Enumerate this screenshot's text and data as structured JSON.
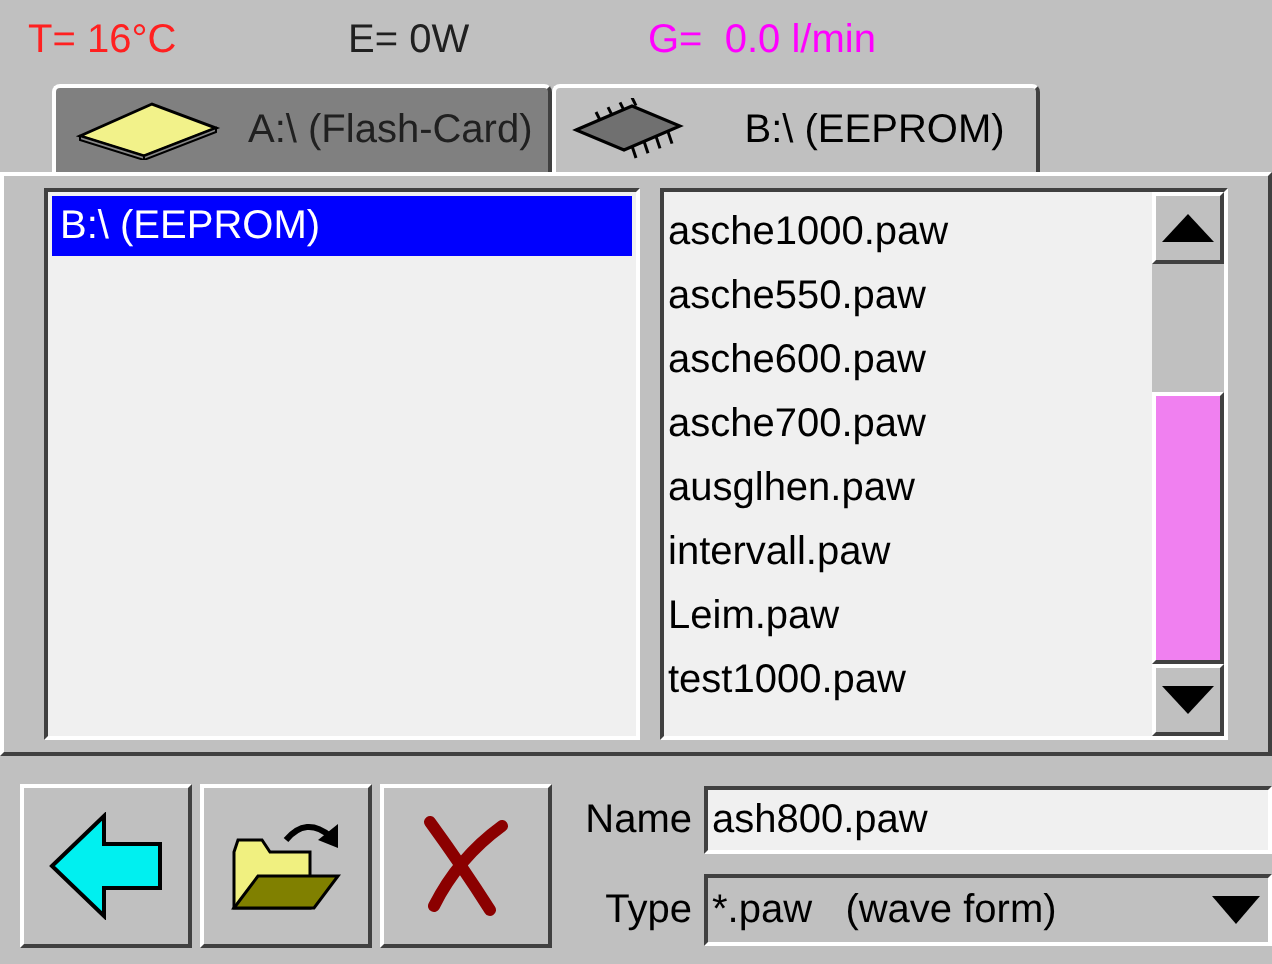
{
  "status_bar": [
    {
      "kind": "temperature",
      "text": "T= 16°C"
    },
    {
      "kind": "energy",
      "text": "E= 0W"
    },
    {
      "kind": "flow",
      "text": "G=  0.0 l/min"
    }
  ],
  "tabs": [
    {
      "kind": "card",
      "label": "A:\\ (Flash-Card)",
      "selected": false
    },
    {
      "kind": "chip",
      "label": "B:\\ (EEPROM)",
      "selected": true
    }
  ],
  "drives": [
    {
      "label": "B:\\ (EEPROM)",
      "selected": true
    }
  ],
  "files": [
    "asche1000.paw",
    "asche550.paw",
    "asche600.paw",
    "asche700.paw",
    "ausglhen.paw",
    "intervall.paw",
    "Leim.paw",
    "test1000.paw"
  ],
  "toolbar": [
    {
      "kind": "back"
    },
    {
      "kind": "open"
    },
    {
      "kind": "delete"
    }
  ],
  "name_field": {
    "label": "Name",
    "value": "ash800.paw"
  },
  "type_field": {
    "label": "Type",
    "value": "*.paw   (wave form)"
  }
}
